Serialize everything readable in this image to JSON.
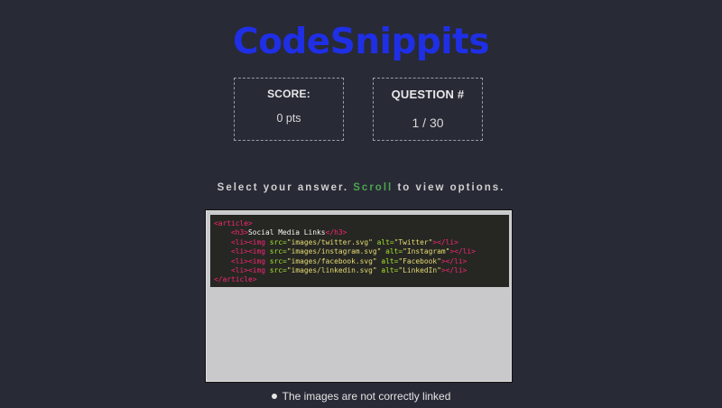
{
  "app": {
    "title": "CodeSnippits"
  },
  "score": {
    "label": "SCORE:",
    "value": "0 pts"
  },
  "question": {
    "label": "QUESTION #",
    "value": "1 / 30"
  },
  "instruction": {
    "before": "Select your answer.",
    "highlight": "Scroll",
    "after": "to view options."
  },
  "code": {
    "lines": [
      [
        {
          "t": "tag",
          "v": "<"
        },
        {
          "t": "tag",
          "v": "article"
        },
        {
          "t": "tag",
          "v": ">"
        }
      ],
      [
        {
          "t": "txt",
          "v": "    "
        },
        {
          "t": "tag",
          "v": "<h3"
        },
        {
          "t": "tag",
          "v": ">"
        },
        {
          "t": "txt",
          "v": "Social Media Links"
        },
        {
          "t": "tag",
          "v": "</h3>"
        }
      ],
      [
        {
          "t": "txt",
          "v": "    "
        },
        {
          "t": "tag",
          "v": "<li>"
        },
        {
          "t": "tag",
          "v": "<img "
        },
        {
          "t": "attr",
          "v": "src="
        },
        {
          "t": "str",
          "v": "\"images/twitter.svg\""
        },
        {
          "t": "txt",
          "v": " "
        },
        {
          "t": "attr",
          "v": "alt="
        },
        {
          "t": "str",
          "v": "\"Twitter\""
        },
        {
          "t": "tag",
          "v": "></li>"
        }
      ],
      [
        {
          "t": "txt",
          "v": "    "
        },
        {
          "t": "tag",
          "v": "<li>"
        },
        {
          "t": "tag",
          "v": "<img "
        },
        {
          "t": "attr",
          "v": "src="
        },
        {
          "t": "str",
          "v": "\"images/instagram.svg\""
        },
        {
          "t": "txt",
          "v": " "
        },
        {
          "t": "attr",
          "v": "alt="
        },
        {
          "t": "str",
          "v": "\"Instagram\""
        },
        {
          "t": "tag",
          "v": "></li>"
        }
      ],
      [
        {
          "t": "txt",
          "v": "    "
        },
        {
          "t": "tag",
          "v": "<li>"
        },
        {
          "t": "tag",
          "v": "<img "
        },
        {
          "t": "attr",
          "v": "src="
        },
        {
          "t": "str",
          "v": "\"images/facebook.svg\""
        },
        {
          "t": "txt",
          "v": " "
        },
        {
          "t": "attr",
          "v": "alt="
        },
        {
          "t": "str",
          "v": "\"Facebook\""
        },
        {
          "t": "tag",
          "v": "></li>"
        }
      ],
      [
        {
          "t": "txt",
          "v": "    "
        },
        {
          "t": "tag",
          "v": "<li>"
        },
        {
          "t": "tag",
          "v": "<img "
        },
        {
          "t": "attr",
          "v": "src="
        },
        {
          "t": "str",
          "v": "\"images/linkedin.svg\""
        },
        {
          "t": "txt",
          "v": " "
        },
        {
          "t": "attr",
          "v": "alt="
        },
        {
          "t": "str",
          "v": "\"LinkedIn\""
        },
        {
          "t": "tag",
          "v": "></li>"
        }
      ],
      [
        {
          "t": "tag",
          "v": "</article>"
        }
      ]
    ]
  },
  "options": [
    {
      "label": "The images are not correctly linked"
    }
  ],
  "colors": {
    "background": "#282a36",
    "title": "#1f2fe6",
    "scroll_highlight": "#4fa34f",
    "code_tag": "#f92672",
    "code_attr": "#a6e22e",
    "code_string": "#e6db74"
  }
}
